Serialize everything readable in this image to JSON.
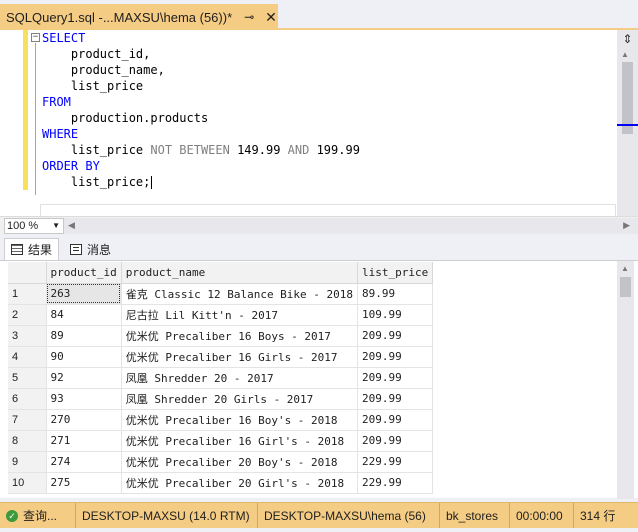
{
  "tab": {
    "title": "SQLQuery1.sql -...MAXSU\\hema (56))*",
    "pin": "⊸",
    "close": "✕"
  },
  "editor": {
    "lines": [
      {
        "kw": "SELECT",
        "text": ""
      },
      {
        "kw": "",
        "text": "    product_id,"
      },
      {
        "kw": "",
        "text": "    product_name,"
      },
      {
        "kw": "",
        "text": "    list_price"
      },
      {
        "kw": "FROM",
        "text": ""
      },
      {
        "kw": "",
        "text": "    production.products"
      },
      {
        "kw": "WHERE",
        "text": ""
      },
      {
        "kw": "",
        "text": "    list_price ",
        "gray": "NOT BETWEEN",
        "rest_a": " 149.99 ",
        "and": "AND",
        "rest_b": " 199.99"
      },
      {
        "kw": "ORDER BY",
        "text": ""
      },
      {
        "kw": "",
        "text": "    list_price;"
      }
    ],
    "split_icon": "⇕"
  },
  "zoom": {
    "value": "100 %"
  },
  "results_tabs": [
    {
      "label": "结果",
      "icon": "grid-icon"
    },
    {
      "label": "消息",
      "icon": "messages-icon"
    }
  ],
  "grid": {
    "columns": [
      "product_id",
      "product_name",
      "list_price"
    ],
    "rows": [
      {
        "n": "1",
        "id": "263",
        "name": "雀克 Classic 12 Balance Bike - 2018",
        "price": "89.99"
      },
      {
        "n": "2",
        "id": "84",
        "name": "尼古拉 Lil Kitt'n - 2017",
        "price": "109.99"
      },
      {
        "n": "3",
        "id": "89",
        "name": "优米优 Precaliber 16 Boys - 2017",
        "price": "209.99"
      },
      {
        "n": "4",
        "id": "90",
        "name": "优米优 Precaliber 16 Girls - 2017",
        "price": "209.99"
      },
      {
        "n": "5",
        "id": "92",
        "name": "凤凰 Shredder 20 - 2017",
        "price": "209.99"
      },
      {
        "n": "6",
        "id": "93",
        "name": "凤凰 Shredder 20 Girls - 2017",
        "price": "209.99"
      },
      {
        "n": "7",
        "id": "270",
        "name": "优米优 Precaliber 16 Boy's - 2018",
        "price": "209.99"
      },
      {
        "n": "8",
        "id": "271",
        "name": "优米优 Precaliber 16 Girl's - 2018",
        "price": "209.99"
      },
      {
        "n": "9",
        "id": "274",
        "name": "优米优 Precaliber 20 Boy's - 2018",
        "price": "229.99"
      },
      {
        "n": "10",
        "id": "275",
        "name": "优米优 Precaliber 20 Girl's - 2018",
        "price": "229.99"
      }
    ]
  },
  "status": {
    "state": "查询...",
    "server": "DESKTOP-MAXSU (14.0 RTM)",
    "login": "DESKTOP-MAXSU\\hema (56)",
    "database": "bk_stores",
    "elapsed": "00:00:00",
    "rows": "314 行"
  }
}
